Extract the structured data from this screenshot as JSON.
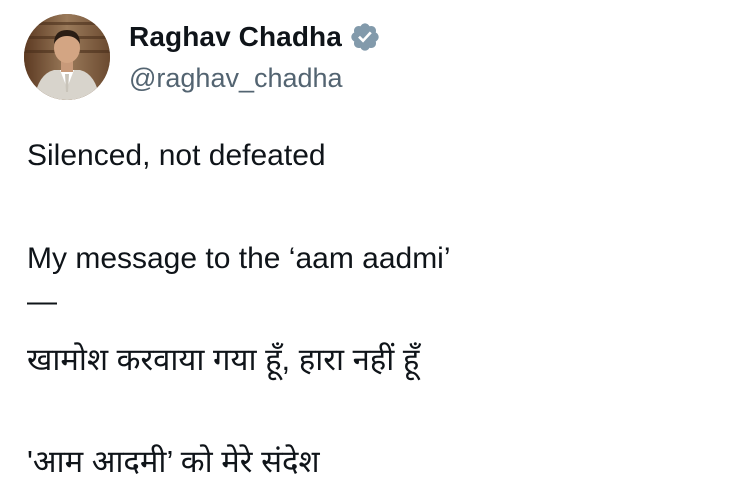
{
  "tweet": {
    "author": {
      "display_name": "Raghav Chadha",
      "handle": "@raghav_chadha",
      "verified_icon": "verified-badge-icon",
      "verified_color": "#829aab"
    },
    "lines": [
      "Silenced, not defeated",
      "My message to the ‘aam aadmi’",
      "—",
      "खामोश करवाया गया हूँ, हारा नहीं हूँ",
      "'आम आदमी’ को मेरे संदेश"
    ]
  }
}
